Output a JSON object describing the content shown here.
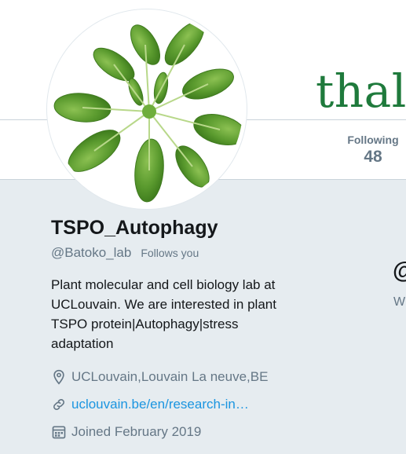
{
  "banner": {
    "word": "thali"
  },
  "nav": {
    "following_label": "Following",
    "following_count": "48"
  },
  "profile": {
    "name": "TSPO_Autophagy",
    "handle": "@Batoko_lab",
    "follows_you": "Follows you",
    "bio": "Plant molecular and cell biology lab at UCLouvain. We are interested in plant TSPO protein|Autophagy|stress adaptation",
    "location": "UCLouvain,Louvain La neuve,BE",
    "website": "uclouvain.be/en/research-in…",
    "joined": "Joined February 2019"
  },
  "side": {
    "at_glyph": "@",
    "w_text": "W"
  },
  "colors": {
    "link": "#1b95e0",
    "muted": "#657786",
    "text": "#14171a",
    "background": "#e6ecf0"
  },
  "icons": [
    "location-pin-icon",
    "link-icon",
    "calendar-icon"
  ]
}
